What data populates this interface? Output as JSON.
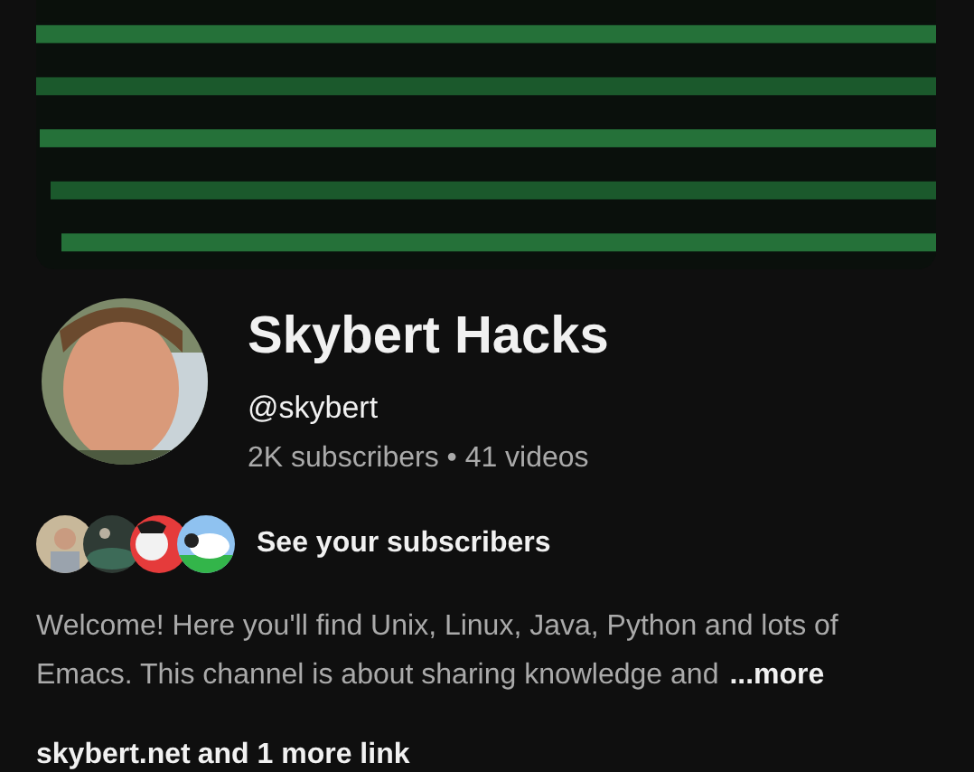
{
  "channel": {
    "name": "Skybert Hacks",
    "handle": "@skybert",
    "stats": "2K subscribers • 41 videos"
  },
  "subscribers": {
    "label": "See your subscribers"
  },
  "description": {
    "lines": [
      "Welcome! Here you'll find Unix, Linux, Java, Python and lots of",
      "Emacs. This channel is about sharing knowledge and"
    ],
    "more": "...more"
  },
  "links": {
    "primary": "skybert.net",
    "more": "and 1 more link"
  }
}
